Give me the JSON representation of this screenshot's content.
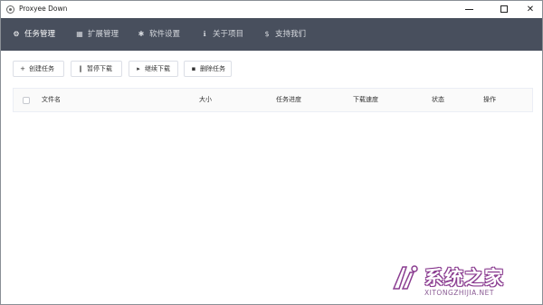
{
  "window": {
    "title": "Proxyee Down",
    "minimize_label": "",
    "maximize_label": "",
    "close_label": "✕"
  },
  "nav": {
    "items": [
      {
        "label": "任务管理",
        "icon": "task-icon",
        "glyph": "⚙",
        "active": true
      },
      {
        "label": "扩展管理",
        "icon": "extension-icon",
        "glyph": "▦",
        "active": false
      },
      {
        "label": "软件设置",
        "icon": "settings-icon",
        "glyph": "✱",
        "active": false
      },
      {
        "label": "关于项目",
        "icon": "info-icon",
        "glyph": "ℹ",
        "active": false
      },
      {
        "label": "支持我们",
        "icon": "dollar-icon",
        "glyph": "$",
        "active": false
      }
    ]
  },
  "toolbar": {
    "create": {
      "label": "创建任务",
      "glyph": "+"
    },
    "pause": {
      "label": "暂停下载",
      "glyph": "‖"
    },
    "resume": {
      "label": "继续下载",
      "glyph": "▸"
    },
    "delete": {
      "label": "删除任务",
      "glyph": "▪"
    }
  },
  "table": {
    "columns": [
      "文件名",
      "大小",
      "任务进度",
      "下载速度",
      "状态",
      "操作"
    ],
    "rows": []
  },
  "watermark": {
    "text": "系统之家",
    "url": "XITONGZHIJIA.NET"
  },
  "colors": {
    "nav_bg": "#484f5d",
    "nav_text": "#d6d9de",
    "nav_active": "#ffffff",
    "watermark": "#8a3c90"
  }
}
